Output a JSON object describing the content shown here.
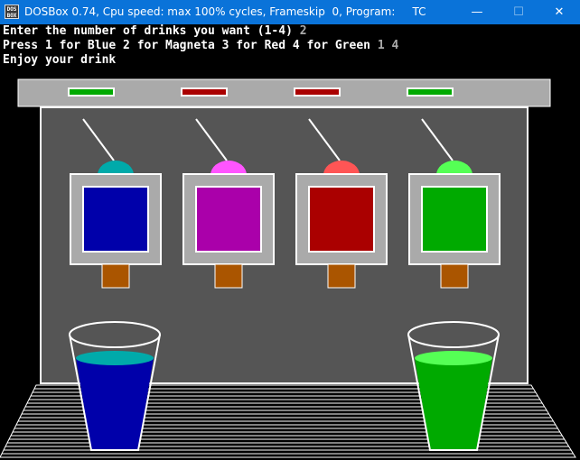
{
  "window": {
    "icon_label": "DOS BOX",
    "title": "DOSBox 0.74, Cpu speed: max 100% cycles, Frameskip  0, Program:     TC",
    "minimize_glyph": "—",
    "maximize_glyph": "☐",
    "close_glyph": "✕"
  },
  "console": {
    "lines": [
      {
        "prompt": "Enter the number of drinks you want (1-4) ",
        "input": "2"
      },
      {
        "prompt": "Press 1 for Blue 2 for Magneta 3 for Red 4 for Green ",
        "input": "1 4"
      },
      {
        "prompt": "Enjoy your drink",
        "input": ""
      }
    ]
  },
  "dispensers": [
    {
      "name": "Blue",
      "indicator_color": "#00aa00",
      "knob_color": "#00aaaa",
      "panel_color": "#0000aa"
    },
    {
      "name": "Magneta",
      "indicator_color": "#aa0000",
      "knob_color": "#ff55ff",
      "panel_color": "#aa00aa"
    },
    {
      "name": "Red",
      "indicator_color": "#aa0000",
      "knob_color": "#ff5555",
      "panel_color": "#aa0000"
    },
    {
      "name": "Green",
      "indicator_color": "#00aa00",
      "knob_color": "#55ff55",
      "panel_color": "#00aa00"
    }
  ],
  "glasses": [
    {
      "drink": "Blue",
      "fill_color": "#0000aa",
      "surface_color": "#00aaaa"
    },
    {
      "drink": "Green",
      "fill_color": "#00aa00",
      "surface_color": "#55ff55"
    }
  ],
  "colors": {
    "titlebar": "#0a73d9",
    "machine_body": "#555555",
    "machine_top": "#aaaaaa",
    "nozzle": "#aa5500",
    "outline": "#ffffff"
  }
}
